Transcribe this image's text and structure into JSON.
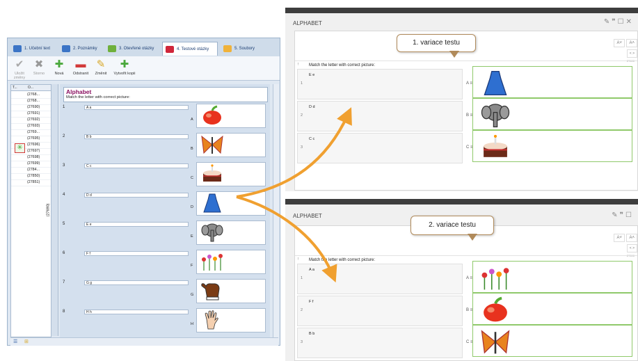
{
  "editor": {
    "tabs": [
      {
        "label": "1. Učební text",
        "color": "#3b74c6"
      },
      {
        "label": "2. Poznámky",
        "color": "#3b74c6"
      },
      {
        "label": "3. Otevřené otázky",
        "color": "#6fb03c"
      },
      {
        "label": "4. Testové otázky",
        "color": "#d0263a"
      },
      {
        "label": "5. Soubory",
        "color": "#f0b23a"
      }
    ],
    "ribbon": {
      "save": "Uložit změny",
      "cancel": "Storno",
      "new": "Nová",
      "remove": "Odstranit",
      "change": "Změnit",
      "copy": "Vytvořit kopii"
    },
    "list": {
      "head_t": "T...",
      "head_o": "O...",
      "rows": [
        "(2768...",
        "(2768...",
        "(27690)",
        "(27691)",
        "(27692)",
        "(27693)",
        "(2769...",
        "(27695)",
        "(27696)",
        "(27697)",
        "(27698)",
        "(27699)",
        "(2784...",
        "(27850)",
        "(27851)"
      ]
    },
    "vtab_label": "(27690)",
    "question": {
      "title": "Alphabet",
      "prompt": "Match the letter with correct picture:",
      "pairs": [
        {
          "num": "1",
          "text": "A a",
          "letter": "A",
          "picture": "apple"
        },
        {
          "num": "2",
          "text": "B b",
          "letter": "B",
          "picture": "butterfly"
        },
        {
          "num": "3",
          "text": "C c",
          "letter": "C",
          "picture": "cake"
        },
        {
          "num": "4",
          "text": "D d",
          "letter": "D",
          "picture": "dress"
        },
        {
          "num": "5",
          "text": "E e",
          "letter": "E",
          "picture": "elephant"
        },
        {
          "num": "6",
          "text": "F f",
          "letter": "F",
          "picture": "flowers"
        },
        {
          "num": "7",
          "text": "G g",
          "letter": "G",
          "picture": "glove"
        },
        {
          "num": "8",
          "text": "H h",
          "letter": "H",
          "picture": "hand"
        }
      ]
    }
  },
  "variant1": {
    "title": "ALPHABET",
    "callout": "1. variace testu",
    "prompt": "Match the letter with correct picture:",
    "bang": "!",
    "id": "27690",
    "font_up": "A˄",
    "font_down": "A˅",
    "nav": "<  >",
    "rows": [
      {
        "num": "1",
        "text": "E e",
        "letter": "A",
        "picture": "dress"
      },
      {
        "num": "2",
        "text": "D d",
        "letter": "B",
        "picture": "elephant"
      },
      {
        "num": "3",
        "text": "C c",
        "letter": "C",
        "picture": "cake"
      }
    ]
  },
  "variant2": {
    "title": "ALPHABET",
    "callout": "2. variace testu",
    "prompt": "Match the letter with correct picture:",
    "bang": "!",
    "id": "27690",
    "font_up": "A˄",
    "font_down": "A˅",
    "nav": "<  >",
    "rows": [
      {
        "num": "1",
        "text": "A a",
        "letter": "A",
        "picture": "flowers"
      },
      {
        "num": "2",
        "text": "F f",
        "letter": "B",
        "picture": "apple"
      },
      {
        "num": "3",
        "text": "B b",
        "letter": "C",
        "picture": "butterfly"
      }
    ]
  },
  "colors": {
    "accent_orange": "#f0a030",
    "title_purple": "#8a1060",
    "correct_green": "#8fc96a"
  }
}
